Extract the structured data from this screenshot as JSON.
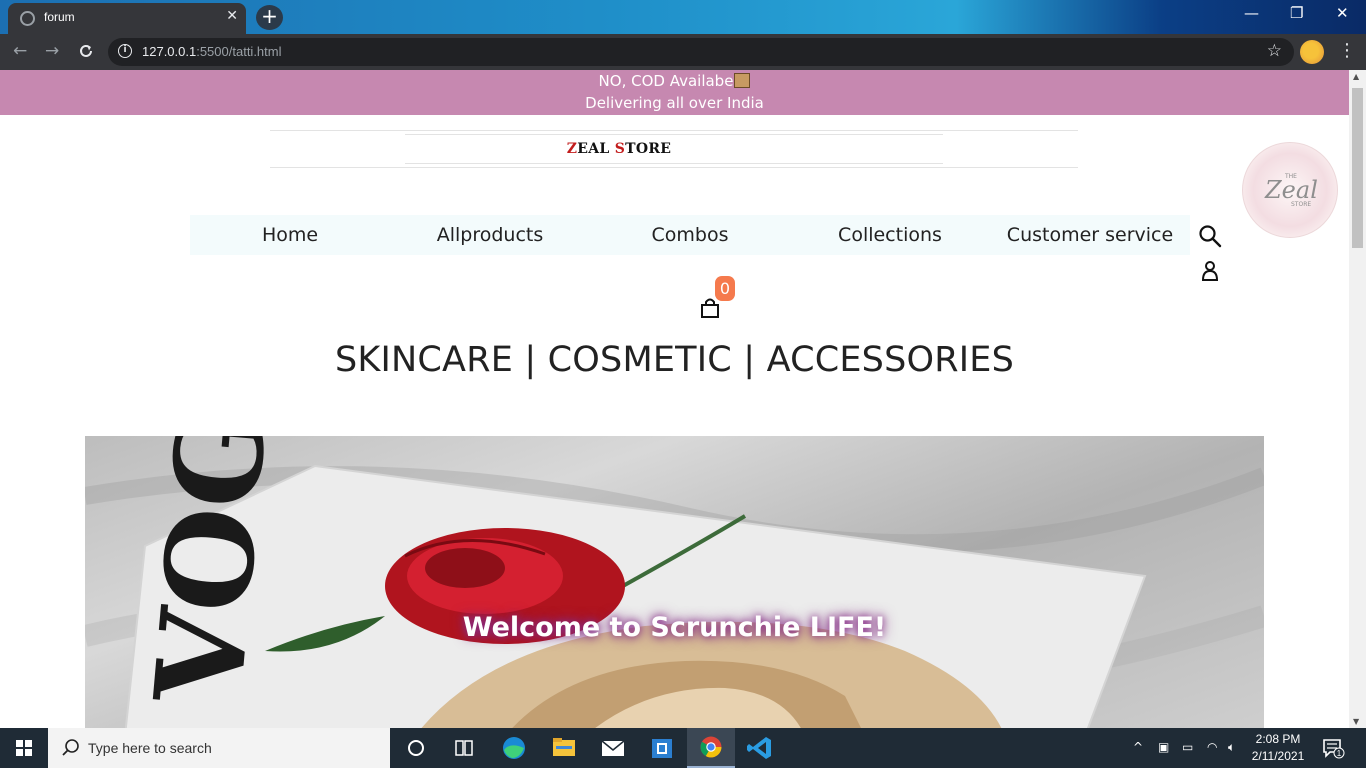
{
  "browser": {
    "tab_title": "forum",
    "new_tab_label": "+",
    "url_host": "127.0.0.1",
    "url_rest": ":5500/tatti.html"
  },
  "page": {
    "announcement_line1": "NO, COD Availabe",
    "announcement_line2": "Delivering all over India",
    "brand": {
      "z": "Z",
      "eal": "EAL ",
      "s": "S",
      "tore": "TORE"
    },
    "logo": {
      "small_top": "THE",
      "main": "Zeal",
      "small_bottom": "STORE"
    },
    "nav": [
      "Home",
      "Allproducts",
      "Combos",
      "Collections",
      "Customer service"
    ],
    "cart_count": "0",
    "tagline": "SKINCARE | COSMETIC | ACCESSORIES",
    "hero": {
      "welcome": "Welcome to Scrunchie LIFE!",
      "magazine_title": "VOGUE"
    }
  },
  "taskbar": {
    "search_placeholder": "Type here to search",
    "time": "2:08 PM",
    "date": "2/11/2021",
    "notification_count": "1"
  },
  "colors": {
    "announcement_bg": "#c688b0",
    "brand_accent": "#c21c1c",
    "badge": "#f57a4d",
    "nav_bg": "#f3fbfc"
  }
}
